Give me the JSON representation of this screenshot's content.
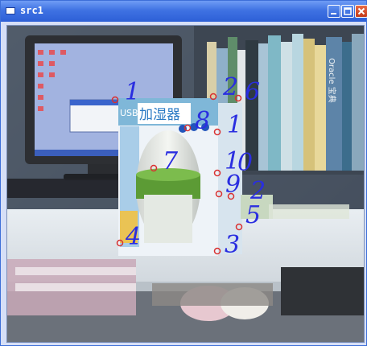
{
  "window": {
    "title": "src1"
  },
  "icons": {
    "minimize": "minimize-icon",
    "maximize": "maximize-icon",
    "close": "close-icon",
    "app": "window-icon"
  },
  "scene": {
    "monitor_screen_color": "#b7c4e8",
    "box_text": "加湿器",
    "box_badge": "USB",
    "book_title": "Oracle 宝典"
  },
  "markers": {
    "color": "#d93030",
    "labels": [
      "1",
      "2",
      "6",
      "8",
      "1",
      "7",
      "1",
      "0",
      "9",
      "2",
      "5",
      "4",
      "3"
    ]
  }
}
